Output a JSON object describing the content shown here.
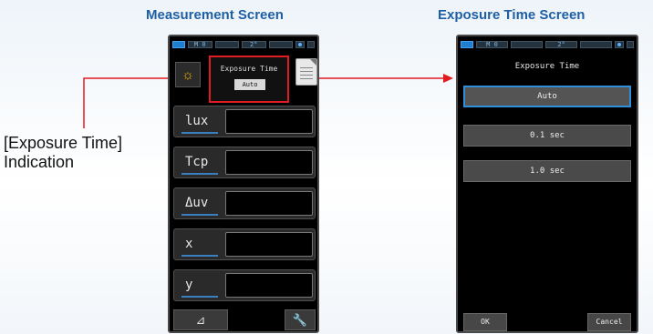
{
  "captions": {
    "measurement_screen": "Measurement Screen",
    "exposure_time_screen": "Exposure Time Screen"
  },
  "indication_label": {
    "line1": "[Exposure Time]",
    "line2": "Indication"
  },
  "measurement_screen": {
    "status_bar": {
      "mode": "M 0",
      "angle": "2°"
    },
    "exposure_time_title": "Exposure Time",
    "exposure_time_value": "Auto",
    "rows": [
      {
        "label": "lux"
      },
      {
        "label": "Tcp"
      },
      {
        "label": "Δuv"
      },
      {
        "label": "x"
      },
      {
        "label": "y"
      }
    ],
    "bottom": {
      "left_icon": "delta-icon",
      "right_icon": "wrench-icon"
    }
  },
  "exposure_time_screen": {
    "status_bar": {
      "mode": "M 0",
      "angle": "2°"
    },
    "title": "Exposure Time",
    "options": [
      "Auto",
      "0.1 sec",
      "1.0 sec"
    ],
    "selected_option": "Auto",
    "ok_label": "OK",
    "cancel_label": "Cancel"
  },
  "colors": {
    "caption_blue": "#1f5fa4",
    "highlight_red": "#e11b22",
    "selected_blue": "#2f8fd8"
  }
}
